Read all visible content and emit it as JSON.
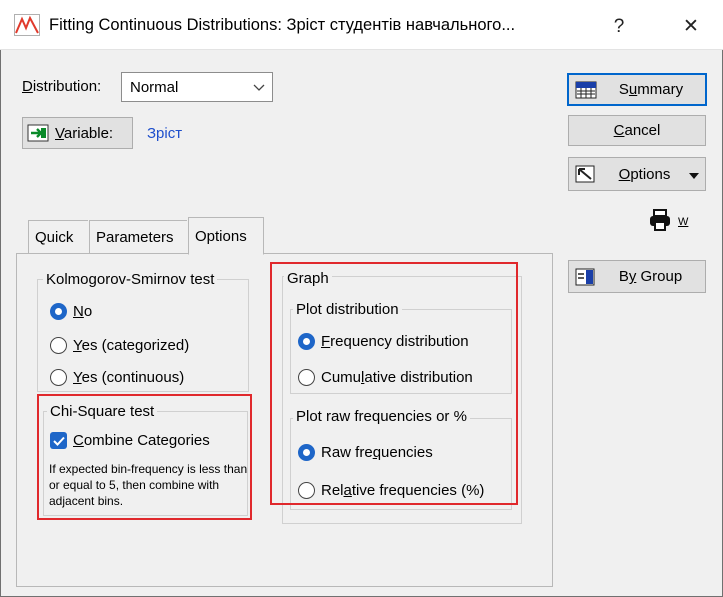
{
  "window": {
    "title": "Fitting Continuous Distributions: Зріст студентів навчального...",
    "help": "?",
    "close": "✕"
  },
  "distribution": {
    "label": "Distribution:",
    "value": "Normal"
  },
  "variable": {
    "button_label": "Variable:",
    "value": "Зріст"
  },
  "tabs": [
    {
      "label": "Quick"
    },
    {
      "label": "Parameters"
    },
    {
      "label": "Options",
      "active": true
    }
  ],
  "ks_test": {
    "title": "Kolmogorov-Smirnov test",
    "options": [
      "No",
      "Yes (categorized)",
      "Yes (continuous)"
    ],
    "selected": "No"
  },
  "chi_square": {
    "title": "Chi-Square test",
    "checkbox_label": "Combine Categories",
    "checked": true,
    "hint": "If expected bin-frequency is less than or equal to 5, then combine with adjacent bins."
  },
  "graph": {
    "title": "Graph",
    "plot_distribution": {
      "title": "Plot distribution",
      "options": [
        "Frequency distribution",
        "Cumulative distribution"
      ],
      "selected": "Frequency distribution"
    },
    "plot_raw": {
      "title": "Plot raw frequencies or %",
      "options": [
        "Raw frequencies",
        "Relative frequencies (%)"
      ],
      "selected": "Raw frequencies"
    }
  },
  "side_buttons": {
    "summary": "Summary",
    "cancel": "Cancel",
    "options": "Options",
    "w": "W",
    "by_group": "By Group"
  },
  "colors": {
    "accent": "#1e66c8",
    "highlight": "#e0282c",
    "link": "#1e4fcc"
  }
}
